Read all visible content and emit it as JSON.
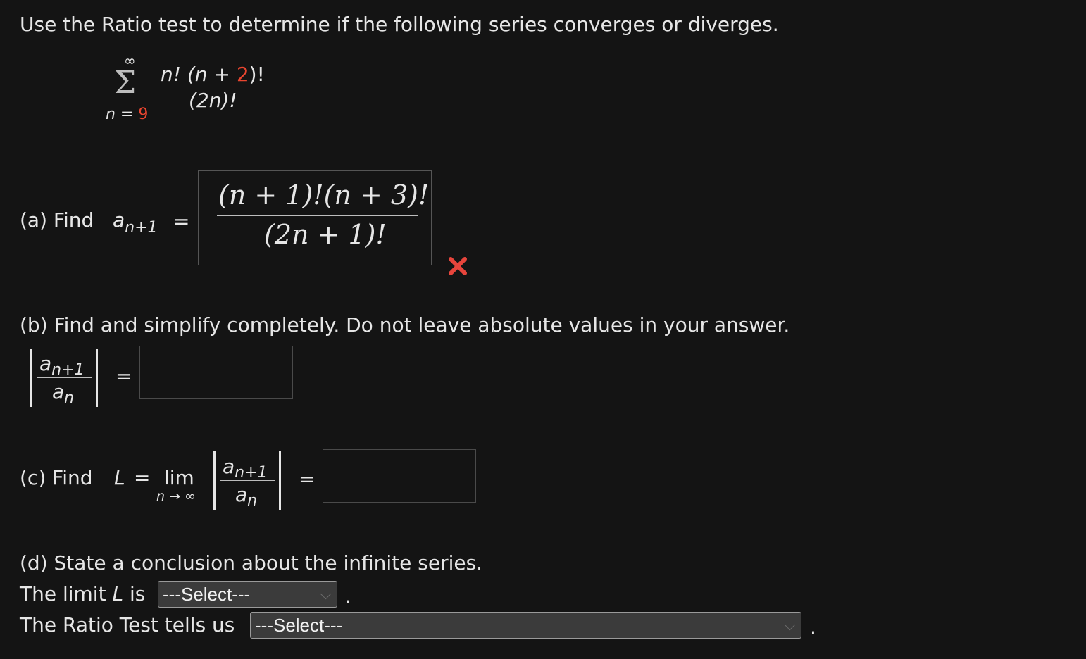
{
  "question": {
    "prompt": "Use the Ratio test to determine if the following series converges or diverges.",
    "series": {
      "sum_symbol": "Σ",
      "upper_limit": "∞",
      "lower_var": "n =",
      "lower_value": "9",
      "numerator_a": "n! (n + ",
      "numerator_num": "2",
      "numerator_b": ")!",
      "denominator": "(2n)!"
    }
  },
  "part_a": {
    "label": "(a) Find",
    "term": "a",
    "term_sub": "n+1",
    "equals": "=",
    "answer_numerator": "(n + 1)!(n + 3)!",
    "answer_denominator": "(2n + 1)!",
    "status_icon": "incorrect-icon",
    "status_color": "#e8453c"
  },
  "part_b": {
    "label": "(b) Find and simplify completely. Do not leave absolute values in your answer.",
    "frac_num": "a",
    "frac_num_sub": "n+1",
    "frac_den": "a",
    "frac_den_sub": "n",
    "equals": "=",
    "answer_value": ""
  },
  "part_c": {
    "label": "(c) Find",
    "L": "L",
    "equals1": "=",
    "lim": "lim",
    "lim_sub": "n → ∞",
    "frac_num": "a",
    "frac_num_sub": "n+1",
    "frac_den": "a",
    "frac_den_sub": "n",
    "equals2": "=",
    "answer_value": ""
  },
  "part_d": {
    "label": "(d) State a conclusion about the infinite series.",
    "limit_label_a": "The limit ",
    "limit_label_L": "L",
    "limit_label_b": " is",
    "limit_select": "---Select---",
    "ratio_label": "The Ratio Test tells us",
    "ratio_select": "---Select---",
    "period": "."
  }
}
